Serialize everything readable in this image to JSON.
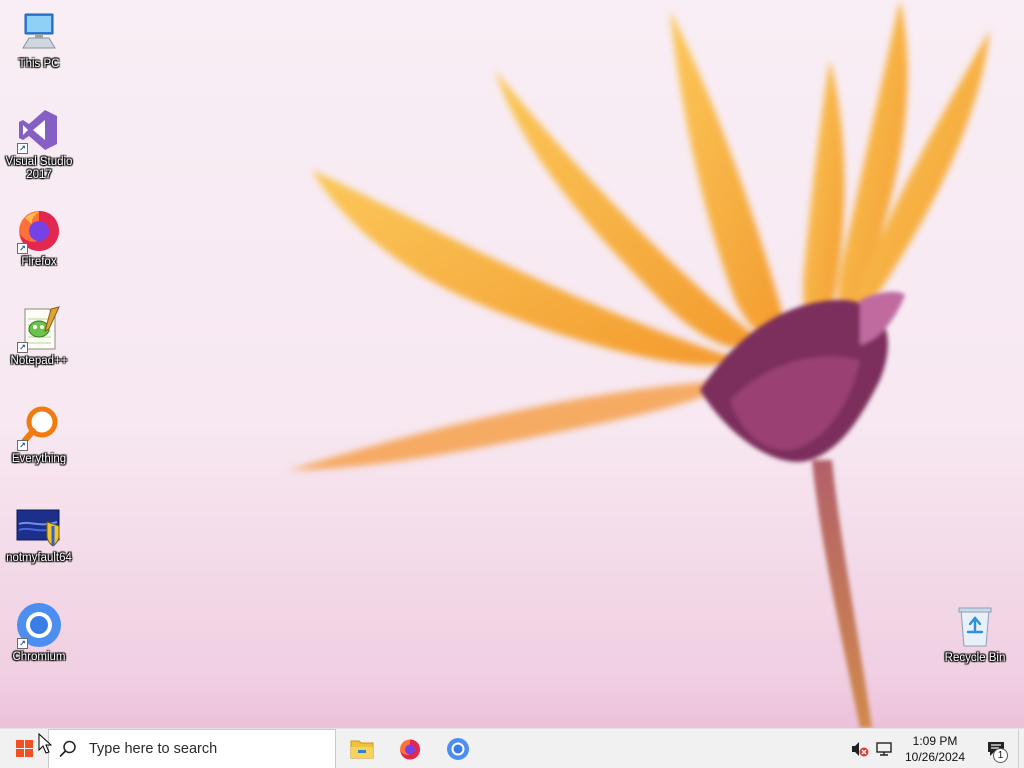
{
  "desktop": {
    "icons": [
      {
        "label": "This PC",
        "icon": "computer-icon"
      },
      {
        "label": "Visual Studio 2017",
        "icon": "visual-studio-icon"
      },
      {
        "label": "Firefox",
        "icon": "firefox-icon"
      },
      {
        "label": "Notepad++",
        "icon": "notepad-plus-plus-icon"
      },
      {
        "label": "Everything",
        "icon": "everything-search-icon"
      },
      {
        "label": "notmyfault64",
        "icon": "notmyfault-icon"
      },
      {
        "label": "Chromium",
        "icon": "chromium-icon"
      },
      {
        "label": "Recycle Bin",
        "icon": "recycle-bin-icon"
      }
    ]
  },
  "taskbar": {
    "search_placeholder": "Type here to search",
    "pinned": [
      {
        "name": "File Explorer",
        "icon": "folder-icon"
      },
      {
        "name": "Firefox",
        "icon": "firefox-icon"
      },
      {
        "name": "Chromium",
        "icon": "chromium-icon"
      }
    ],
    "clock": {
      "time": "1:09 PM",
      "date": "10/26/2024"
    },
    "notification_count": "1"
  },
  "colors": {
    "taskbar_bg": "#f1f1f1",
    "start_red": "#f25022",
    "petal": "#f7b23c",
    "flower_center": "#7a2a5a"
  }
}
